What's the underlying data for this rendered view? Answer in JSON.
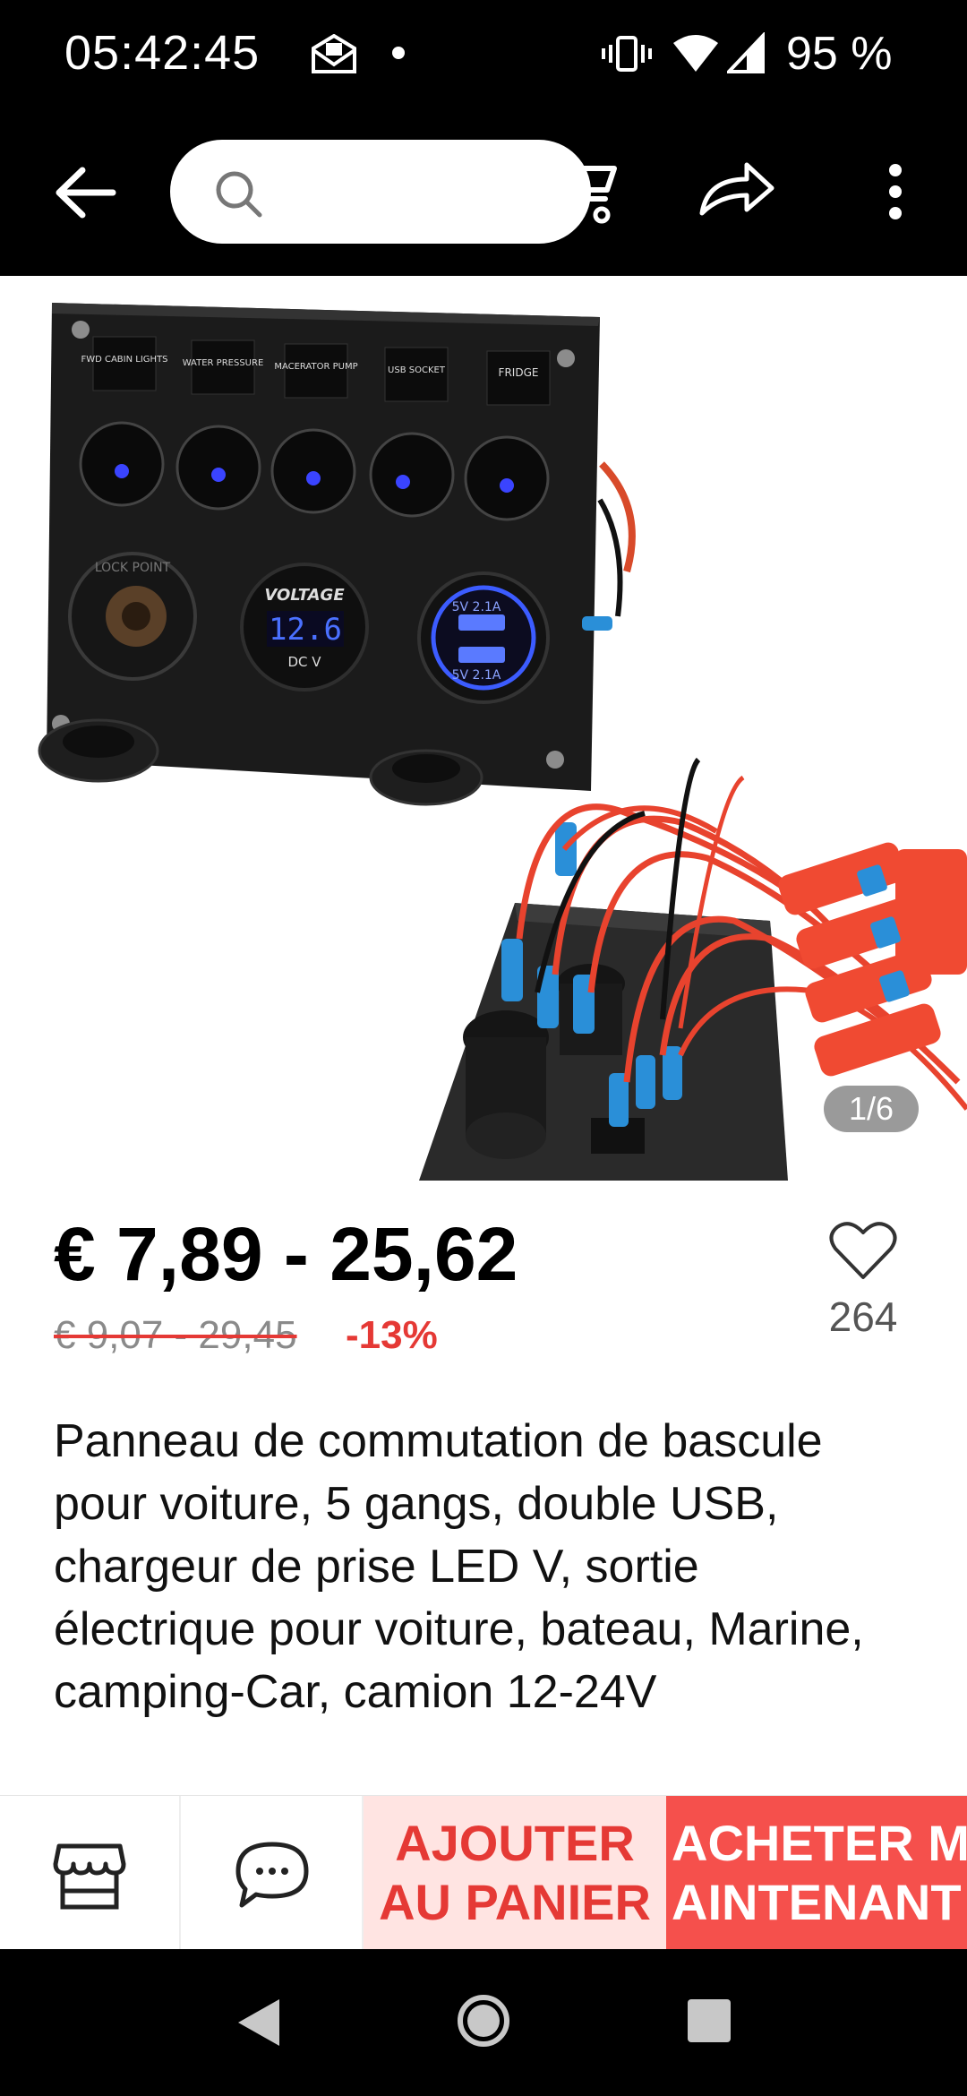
{
  "status_bar": {
    "time": "05:42:45",
    "battery": "95 %"
  },
  "top_nav": {
    "search_placeholder": ""
  },
  "gallery": {
    "counter": "1/6",
    "panel_labels": [
      "FWD CABIN LIGHTS",
      "WATER PRESSURE",
      "MACERATOR PUMP",
      "USB SOCKET",
      "FRIDGE"
    ],
    "voltmeter_title": "VOLTAGE",
    "voltmeter_value": "12.6",
    "voltmeter_units": "DC  V",
    "usb_label_top": "5V 2.1A",
    "usb_label_bottom": "5V 2.1A",
    "socket_label": "LOCK  POINT"
  },
  "product": {
    "price": "€ 7,89 - 25,62",
    "original_price": "€ 9,07 - 29,45",
    "discount": "-13%",
    "wishlist_count": "264",
    "title": "Panneau de commutation de bascule pour voiture, 5 gangs, double USB, chargeur de prise LED V, sortie électrique pour voiture, bateau, Marine, camping-Car, camion 12-24V"
  },
  "actions": {
    "add_to_cart_line1": "AJOUTER",
    "add_to_cart_line2": "AU PANIER",
    "buy_now_line1": "ACHETER M",
    "buy_now_line2": "AINTENANT"
  },
  "colors": {
    "accent": "#e53935",
    "buy_bg": "#f5504c",
    "add_bg": "#ffe4e2"
  }
}
